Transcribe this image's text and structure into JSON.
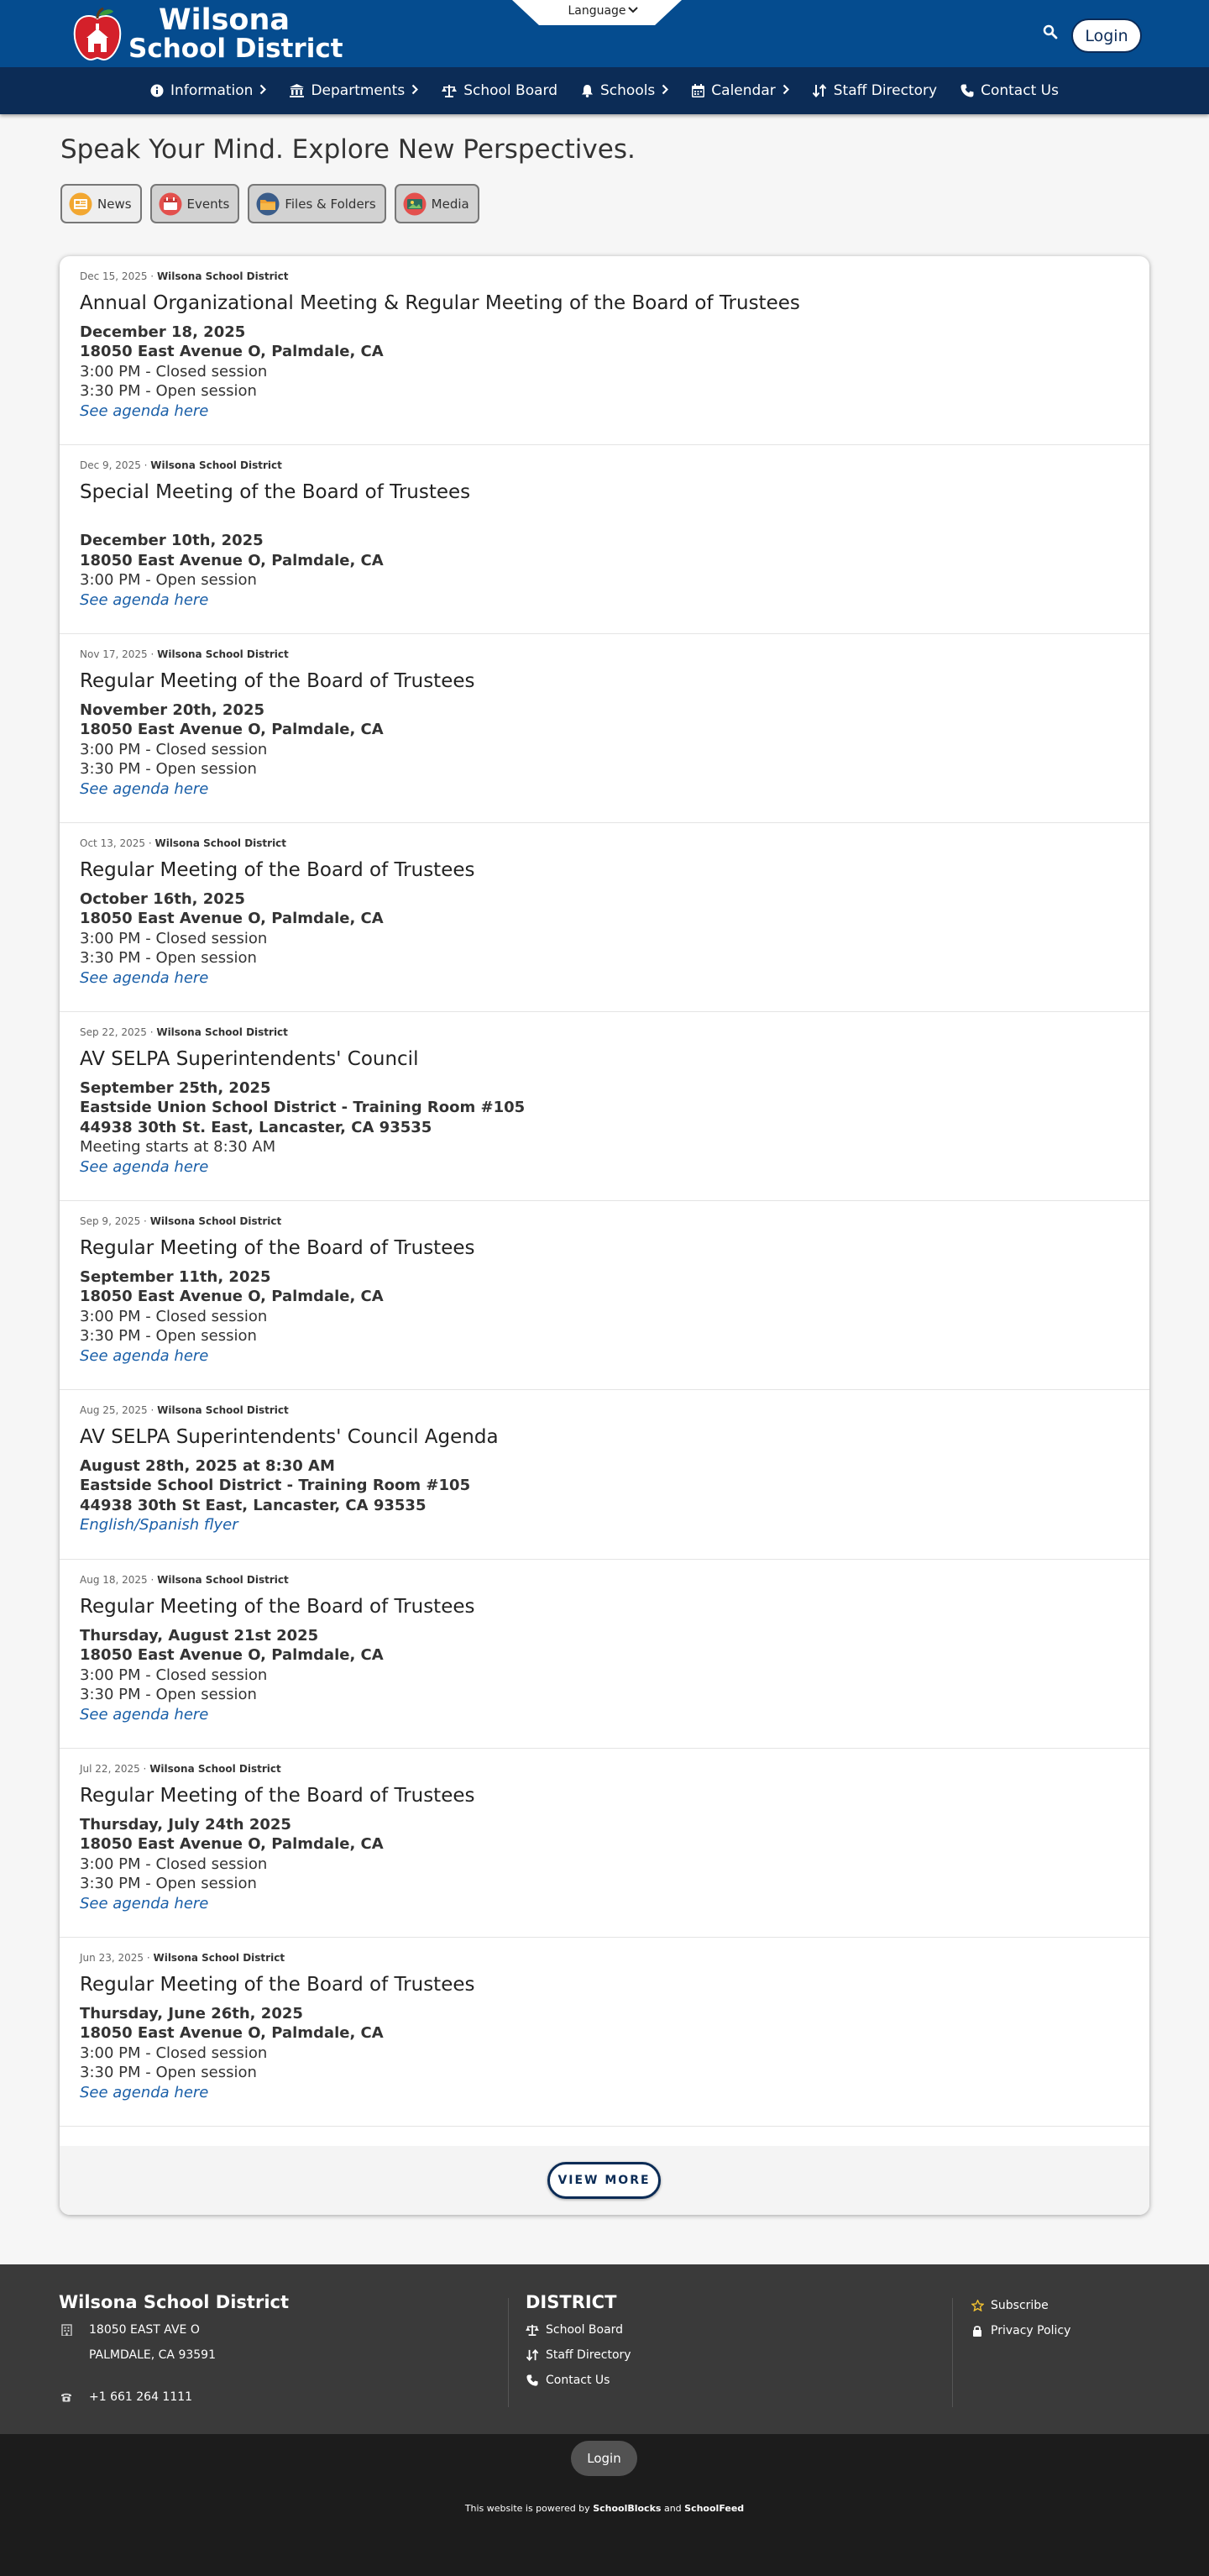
{
  "header": {
    "logo_line1": "Wilsona",
    "logo_line2": "School District",
    "language_label": "Language",
    "login_label": "Login"
  },
  "nav": [
    {
      "label": "Information",
      "icon": "info-icon",
      "has_chevron": true
    },
    {
      "label": "Departments",
      "icon": "bank-icon",
      "has_chevron": true
    },
    {
      "label": "School Board",
      "icon": "scale-icon",
      "has_chevron": false
    },
    {
      "label": "Schools",
      "icon": "bell-icon",
      "has_chevron": true
    },
    {
      "label": "Calendar",
      "icon": "calendar-icon",
      "has_chevron": true
    },
    {
      "label": "Staff Directory",
      "icon": "sort-icon",
      "has_chevron": false
    },
    {
      "label": "Contact Us",
      "icon": "phone-icon",
      "has_chevron": false
    }
  ],
  "page": {
    "title": "Speak Your Mind. Explore New Perspectives.",
    "filters": [
      {
        "label": "News",
        "icon": "news-icon",
        "active": false
      },
      {
        "label": "Events",
        "icon": "calendar-icon",
        "active": true
      },
      {
        "label": "Files & Folders",
        "icon": "folder-icon",
        "active": true
      },
      {
        "label": "Media",
        "icon": "media-icon",
        "active": true
      }
    ],
    "view_more": "VIEW MORE"
  },
  "feed": [
    {
      "date": "Dec 15, 2025",
      "source": "Wilsona School District",
      "title": "Annual Organizational Meeting & Regular Meeting of the Board of Trustees",
      "lines": [
        {
          "text": "December 18, 2025",
          "style": "b"
        },
        {
          "text": "18050 East Avenue O, Palmdale, CA",
          "style": "b"
        },
        {
          "text": "3:00 PM - Closed session",
          "style": ""
        },
        {
          "text": "3:30 PM - Open session",
          "style": ""
        },
        {
          "text": "See agenda here",
          "style": "lk"
        }
      ]
    },
    {
      "date": "Dec 9, 2025",
      "source": "Wilsona School District",
      "title": "Special Meeting of the Board of Trustees",
      "lines": [
        {
          "text": "",
          "style": ""
        },
        {
          "text": "December 10th, 2025",
          "style": "b"
        },
        {
          "text": "18050 East Avenue O, Palmdale, CA",
          "style": "b"
        },
        {
          "text": "3:00 PM - Open session",
          "style": ""
        },
        {
          "text": "See agenda here",
          "style": "lk"
        }
      ]
    },
    {
      "date": "Nov 17, 2025",
      "source": "Wilsona School District",
      "title": "Regular Meeting of the Board of Trustees",
      "lines": [
        {
          "text": "November 20th, 2025",
          "style": "b"
        },
        {
          "text": "18050 East Avenue O, Palmdale, CA",
          "style": "b"
        },
        {
          "text": "3:00 PM - Closed session",
          "style": ""
        },
        {
          "text": "3:30 PM - Open session",
          "style": ""
        },
        {
          "text": "See agenda here",
          "style": "lk"
        }
      ]
    },
    {
      "date": "Oct 13, 2025",
      "source": "Wilsona School District",
      "title": "Regular Meeting of the Board of Trustees",
      "lines": [
        {
          "text": "October 16th, 2025",
          "style": "b"
        },
        {
          "text": "18050 East Avenue O, Palmdale, CA",
          "style": "b"
        },
        {
          "text": "3:00 PM - Closed session",
          "style": ""
        },
        {
          "text": "3:30 PM - Open session",
          "style": ""
        },
        {
          "text": "See agenda here",
          "style": "lk"
        }
      ]
    },
    {
      "date": "Sep 22, 2025",
      "source": "Wilsona School District",
      "title": "AV SELPA Superintendents' Council",
      "lines": [
        {
          "text": "September 25th, 2025",
          "style": "b"
        },
        {
          "text": "Eastside Union School District - Training Room #105",
          "style": "b"
        },
        {
          "text": "44938 30th St. East, Lancaster, CA 93535",
          "style": "b"
        },
        {
          "text": "Meeting starts at 8:30 AM",
          "style": ""
        },
        {
          "text": "See agenda here",
          "style": "lk"
        }
      ]
    },
    {
      "date": "Sep 9, 2025",
      "source": "Wilsona School District",
      "title": "Regular Meeting of the Board of Trustees",
      "lines": [
        {
          "text": "September 11th, 2025",
          "style": "b"
        },
        {
          "text": "18050 East Avenue O, Palmdale, CA",
          "style": "b"
        },
        {
          "text": "3:00 PM - Closed session",
          "style": ""
        },
        {
          "text": "3:30 PM - Open session",
          "style": ""
        },
        {
          "text": "See agenda here",
          "style": "lk"
        }
      ]
    },
    {
      "date": "Aug 25, 2025",
      "source": "Wilsona School District",
      "title": "AV SELPA Superintendents' Council Agenda",
      "lines": [
        {
          "text": "August 28th, 2025 at 8:30 AM",
          "style": "b"
        },
        {
          "text": "Eastside School District - Training Room #105",
          "style": "b"
        },
        {
          "text": "44938 30th St East, Lancaster, CA 93535",
          "style": "b"
        },
        {
          "text": "English/Spanish flyer",
          "style": "lk"
        }
      ]
    },
    {
      "date": "Aug 18, 2025",
      "source": "Wilsona School District",
      "title": "Regular Meeting of the Board of Trustees",
      "lines": [
        {
          "text": "Thursday, August 21st 2025",
          "style": "b"
        },
        {
          "text": "18050 East Avenue O, Palmdale, CA",
          "style": "b"
        },
        {
          "text": "3:00 PM - Closed session",
          "style": ""
        },
        {
          "text": "3:30 PM - Open session",
          "style": ""
        },
        {
          "text": "See agenda here",
          "style": "lk"
        }
      ]
    },
    {
      "date": "Jul 22, 2025",
      "source": "Wilsona School District",
      "title": "Regular Meeting of the Board of Trustees",
      "lines": [
        {
          "text": "Thursday, July 24th 2025",
          "style": "b"
        },
        {
          "text": "18050 East Avenue O, Palmdale, CA",
          "style": "b"
        },
        {
          "text": "3:00 PM - Closed session",
          "style": ""
        },
        {
          "text": "3:30 PM - Open session",
          "style": ""
        },
        {
          "text": "See agenda here",
          "style": "lk"
        }
      ]
    },
    {
      "date": "Jun 23, 2025",
      "source": "Wilsona School District",
      "title": "Regular Meeting of the Board of Trustees",
      "lines": [
        {
          "text": "Thursday, June 26th, 2025",
          "style": "b"
        },
        {
          "text": "18050 East Avenue O, Palmdale, CA",
          "style": "b"
        },
        {
          "text": "3:00 PM - Closed session",
          "style": ""
        },
        {
          "text": "3:30 PM - Open session",
          "style": ""
        },
        {
          "text": "See agenda here",
          "style": "lk"
        }
      ]
    }
  ],
  "footer": {
    "district_name": "Wilsona School District",
    "address1": "18050 EAST AVE O",
    "address2": "PALMDALE, CA 93591",
    "phone": "+1 661 264 1111",
    "section_title": "DISTRICT",
    "links": [
      {
        "label": "School Board",
        "icon": "scale-icon"
      },
      {
        "label": "Staff Directory",
        "icon": "sort-icon"
      },
      {
        "label": "Contact Us",
        "icon": "phone-icon"
      }
    ],
    "subscribe": "Subscribe",
    "privacy": "Privacy Policy"
  },
  "powered": {
    "login": "Login",
    "text_prefix": "This website is powered by",
    "brand1": "SchoolBlocks",
    "and": "and",
    "brand2": "SchoolFeed"
  },
  "colors": {
    "header_blue": "#054c8f",
    "nav_navy": "#0c2c56",
    "link_blue": "#1a5fa8",
    "footer_gray": "#3a3a3a",
    "bottom_black": "#1c1c1c"
  }
}
